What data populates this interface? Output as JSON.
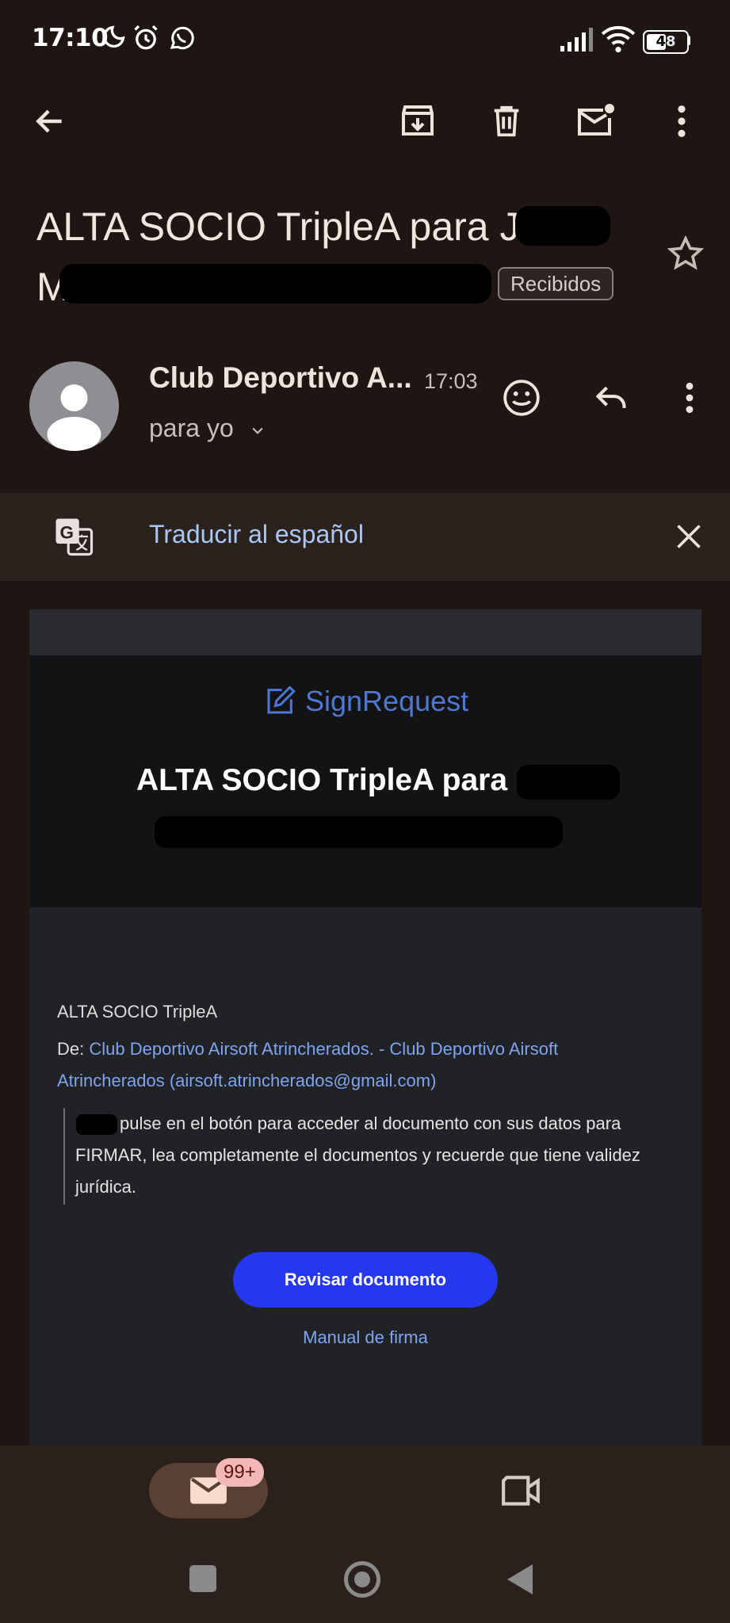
{
  "status_bar": {
    "time": "17:10",
    "battery": "48",
    "icons": [
      "moon-icon",
      "alarm-icon",
      "whatsapp-icon",
      "signal-icon",
      "wifi-icon",
      "battery-icon"
    ]
  },
  "toolbar": {
    "icons": [
      "back-arrow-icon",
      "archive-icon",
      "delete-icon",
      "mark-unread-icon",
      "more-vert-icon"
    ]
  },
  "email": {
    "subject_line1": "ALTA SOCIO TripleA para J",
    "subject_line2": "M",
    "label": "Recibidos",
    "sender_name": "Club Deportivo A...",
    "time": "17:03",
    "to": "para yo"
  },
  "translate": {
    "text": "Traducir al español"
  },
  "body": {
    "brand": "SignRequest",
    "title": "ALTA SOCIO TripleA para",
    "doc_name": "ALTA SOCIO TripleA",
    "from_label": "De: ",
    "from_link_line1": "Club Deportivo Airsoft Atrincherados. - Club Deportivo Airsoft",
    "from_link_line2": "Atrincherados (airsoft.atrincherados@gmail.com)",
    "message": "pulse en el botón para acceder al documento con sus datos para FIRMAR, lea completamente el documentos y recuerde que tiene validez jurídica.",
    "button": "Revisar documento",
    "manual_link": "Manual de firma"
  },
  "bottom_nav": {
    "mail_badge": "99+"
  },
  "colors": {
    "background": "#1f1512",
    "accent_button": "#2638ee",
    "link": "#7fa4f0",
    "translate_text": "#a9c8f5"
  }
}
